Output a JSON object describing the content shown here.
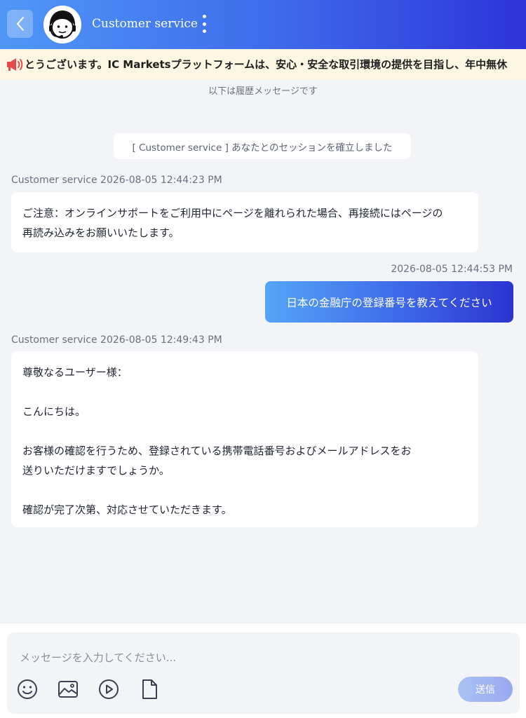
{
  "header": {
    "title": "Customer service",
    "back_icon": "chevron-left-icon",
    "avatar_icon": "support-agent-avatar",
    "more_icon": "more-vertical-icon"
  },
  "notice": {
    "icon": "megaphone-icon",
    "text": "とうございます。IC Marketsプラットフォームは、安心・安全な取引環境の提供を目指し、年中無休"
  },
  "history_label": "以下は履歴メッセージです",
  "session_notice": "[ Customer service ] あなたとのセッションを確立しました",
  "messages": [
    {
      "meta": "Customer service 2026-08-05 12:44:23 PM",
      "lines": [
        "ご注意：オンラインサポートをご利用中にページを離れられた場合、再接続にはページの",
        "再読み込みをお願いいたします。"
      ]
    },
    {
      "meta": "2026-08-05 12:44:53 PM",
      "text": "日本の金融庁の登録番号を教えてください"
    },
    {
      "meta": "Customer service 2026-08-05 12:49:43 PM",
      "paragraphs": [
        "尊敬なるユーザー様：",
        "こんにちは。",
        "お客様の確認を行うため、登録されている携帯電話番号およびメールアドレスをお",
        "送りいただけますでしょうか。",
        "確認が完了次第、対応させていただきます。"
      ]
    }
  ],
  "composer": {
    "placeholder": "メッセージを入力してください...",
    "value": "",
    "send_label": "送信",
    "tools": [
      "emoji-icon",
      "image-icon",
      "video-icon",
      "file-icon"
    ]
  },
  "colors": {
    "header_gradient_start": "#4f97f7",
    "header_gradient_end": "#2d33d8",
    "notice_bg": "#fdf6e3",
    "megaphone": "#e5484d",
    "send_button": "#a9b8f3"
  }
}
